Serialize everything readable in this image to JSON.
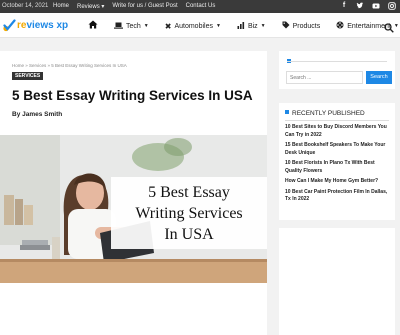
{
  "topbar": {
    "date": "October 14, 2021",
    "links": [
      "Home",
      "Reviews",
      "Write for us / Guest Post",
      "Contact Us"
    ],
    "social_icons": [
      "facebook-icon",
      "twitter-icon",
      "youtube-icon",
      "instagram-icon"
    ]
  },
  "brand": {
    "logo_prefix": "re",
    "logo_mid": "views",
    "logo_suffix": " xp"
  },
  "nav": {
    "items": [
      {
        "label": "Tech",
        "icon": "laptop-icon"
      },
      {
        "label": "Automobiles",
        "icon": "wrench-icon"
      },
      {
        "label": "Biz",
        "icon": "bar-chart-icon"
      },
      {
        "label": "Products",
        "icon": "tag-icon"
      },
      {
        "label": "Entertainment",
        "icon": "film-icon"
      }
    ]
  },
  "article": {
    "breadcrumb": "Home  »  Services  »  5 Best Essay Writing Services In USA",
    "category": "SERVICES",
    "title": "5 Best Essay Writing Services In USA",
    "author": "By James Smith",
    "hero_text_line1": "5 Best Essay",
    "hero_text_line2": "Writing Services",
    "hero_text_line3": "In USA"
  },
  "sidebar": {
    "search_placeholder": "Search ...",
    "search_button": "Search",
    "recent_heading": "RECENTLY PUBLISHED",
    "recent_posts": [
      "10 Best Sites to Buy Discord Members You Can Try in 2022",
      "15 Best Bookshelf Speakers To Make Your Desk Unique",
      "10 Best Florists In Plano Tx With Best Quality Flowers",
      "How Can I Make My Home Gym Better?",
      "10 Best Car Paint Protection Film In Dallas, Tx In 2022"
    ]
  },
  "colors": {
    "accent": "#1e88e5",
    "logo_orange": "#f2a900",
    "topbar": "#3a3a3a"
  }
}
